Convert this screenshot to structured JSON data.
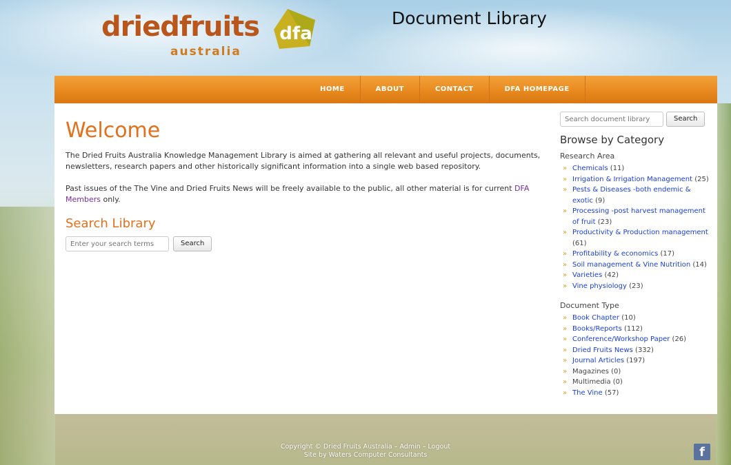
{
  "header": {
    "logo_text": "driedfruits",
    "logo_sub": "australia",
    "logo_mark": "dfa",
    "site_title": "Document Library"
  },
  "nav": {
    "items": [
      {
        "label": "HOME"
      },
      {
        "label": "ABOUT"
      },
      {
        "label": "CONTACT"
      },
      {
        "label": "DFA HOMEPAGE"
      }
    ]
  },
  "main": {
    "welcome": "Welcome",
    "para1": "The Dried Fruits Australia Knowledge Management Library is aimed at gathering all relevant and useful projects, documents, newsletters, research papers and other historically significant information into a single web based repository.",
    "para2_pre": "Past issues of the The Vine and Dried Fruits News will be freely available to the public, all other material is for current ",
    "para2_link": "DFA Members",
    "para2_post": " only.",
    "search_title": "Search Library",
    "search_placeholder": "Enter your search terms",
    "search_button": "Search"
  },
  "sidebar": {
    "search_placeholder": "Search document library",
    "search_button": "Search",
    "browse_title": "Browse by Category",
    "research_label": "Research Area",
    "research": [
      {
        "name": "Chemicals",
        "count": "(11)"
      },
      {
        "name": "Irrigation & Irrigation Management",
        "count": "(25)"
      },
      {
        "name": "Pests & Diseases -both endemic & exotic",
        "count": "(9)"
      },
      {
        "name": "Processing -post harvest management of fruit",
        "count": "(23)"
      },
      {
        "name": "Productivity & Production management",
        "count": "(61)"
      },
      {
        "name": "Profitability & economics",
        "count": "(17)"
      },
      {
        "name": "Soil management & Vine Nutrition",
        "count": "(14)"
      },
      {
        "name": "Varieties",
        "count": "(42)"
      },
      {
        "name": "Vine physiology",
        "count": "(23)"
      }
    ],
    "doctype_label": "Document Type",
    "doctypes": [
      {
        "name": "Book Chapter",
        "count": "(10)",
        "link": true
      },
      {
        "name": "Books/Reports",
        "count": "(112)",
        "link": true
      },
      {
        "name": "Conference/Workshop Paper",
        "count": "(26)",
        "link": true
      },
      {
        "name": "Dried Fruits News",
        "count": "(332)",
        "link": true
      },
      {
        "name": "Journal Articles",
        "count": "(197)",
        "link": true
      },
      {
        "name": "Magazines",
        "count": "(0)",
        "link": false
      },
      {
        "name": "Multimedia",
        "count": "(0)",
        "link": false
      },
      {
        "name": "The Vine",
        "count": "(57)",
        "link": true
      }
    ]
  },
  "footer": {
    "line1": "Copyright © Dried Fruits Australia – Admin – Logout",
    "line2": "Site by Waters Computer Consultants",
    "facebook": "f"
  },
  "colors": {
    "accent_orange": "#e88a1f",
    "heading_orange": "#e2701c",
    "link_blue": "#1a3fd6",
    "member_link_purple": "#7a2aa0"
  }
}
